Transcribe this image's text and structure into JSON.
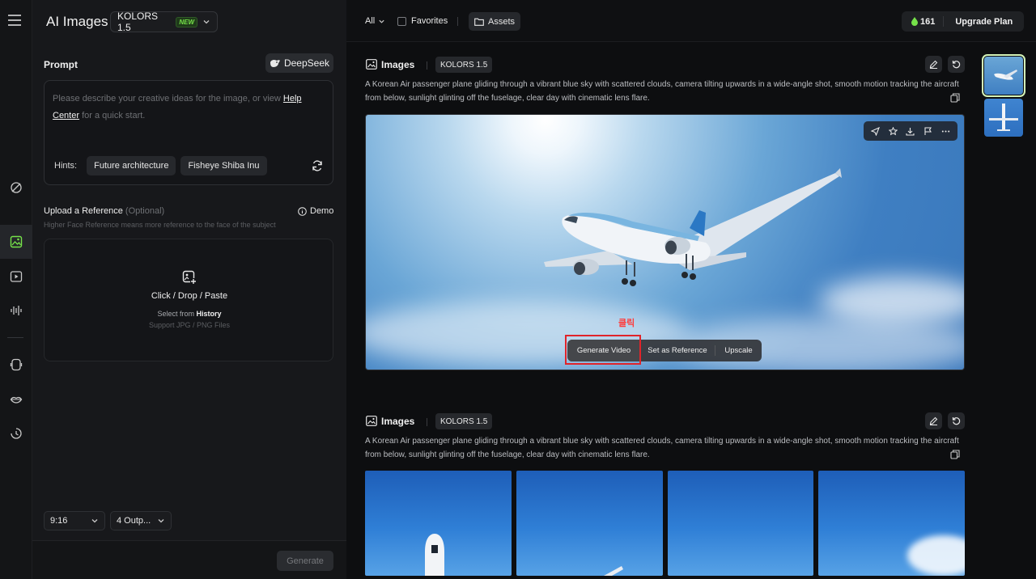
{
  "app": {
    "title": "AI Images",
    "model": "KOLORS 1.5",
    "model_badge": "NEW"
  },
  "prompt": {
    "label": "Prompt",
    "deepseek_label": "DeepSeek",
    "placeholder_before": "Please describe your creative ideas for the image, or view",
    "placeholder_link": "Help Center",
    "placeholder_after": "for a quick start.",
    "hints_label": "Hints:",
    "hints": [
      "Future architecture",
      "Fisheye Shiba Inu"
    ]
  },
  "reference": {
    "label": "Upload a Reference",
    "optional": "(Optional)",
    "subtitle": "Higher Face Reference means more reference to the face of the subject",
    "demo_label": "Demo",
    "drop_title": "Click / Drop / Paste",
    "select_from": "Select from",
    "history": "History",
    "support": "Support JPG / PNG Files"
  },
  "settings": {
    "aspect_ratio": "9:16",
    "outputs": "4 Outp..."
  },
  "generate_label": "Generate",
  "topbar": {
    "filter": "All",
    "favorites": "Favorites",
    "assets": "Assets",
    "credits": "161",
    "upgrade": "Upgrade Plan"
  },
  "sections": [
    {
      "title": "Images",
      "model": "KOLORS 1.5",
      "description": "A Korean Air passenger plane gliding through a vibrant blue sky with scattered clouds, camera tilting upwards in a wide-angle shot, smooth motion tracking the aircraft from below, sunlight glinting off the fuselage, clear day with cinematic lens flare."
    },
    {
      "title": "Images",
      "model": "KOLORS 1.5",
      "description": "A Korean Air passenger plane gliding through a vibrant blue sky with scattered clouds, camera tilting upwards in a wide-angle shot, smooth motion tracking the aircraft from below, sunlight glinting off the fuselage, clear day with cinematic lens flare."
    }
  ],
  "image_actions": {
    "generate_video": "Generate Video",
    "set_as_reference": "Set as Reference",
    "upscale": "Upscale"
  },
  "annotation": "클릭",
  "colors": {
    "accent_green": "#76e24a",
    "highlight_red": "#e0242a"
  }
}
